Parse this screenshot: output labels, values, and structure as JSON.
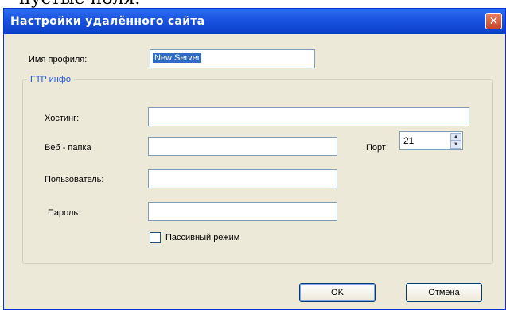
{
  "top_caption": "пустые поля.",
  "window": {
    "title": "Настройки удалённого сайта",
    "close_glyph": "✕"
  },
  "profile": {
    "label": "Имя профиля:",
    "value": "New Server"
  },
  "ftp_group": {
    "legend": "FTP инфо",
    "host_label": "Хостинг:",
    "host_value": "",
    "webfolder_label": "Веб - папка",
    "webfolder_value": "",
    "port_label": "Порт:",
    "port_value": "21",
    "user_label": "Пользователь:",
    "user_value": "",
    "password_label": "Пароль:",
    "password_value": "",
    "passive_label": "Пассивный режим",
    "passive_checked": false
  },
  "buttons": {
    "ok": "OK",
    "cancel": "Отмена"
  },
  "icons": {
    "close": "close-icon",
    "spin_up": "spin-up-icon",
    "spin_down": "spin-down-icon"
  }
}
